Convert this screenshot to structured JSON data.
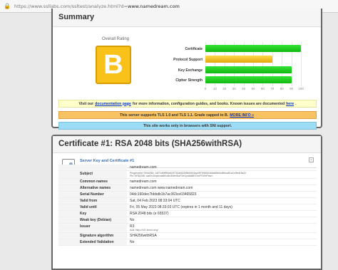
{
  "browser": {
    "url_prefix": "https://www.ssllabs.com/ssltest/analyze.html?d=",
    "url_domain": "www.namedream.com"
  },
  "summary": {
    "title": "Summary",
    "overall_rating_label": "Overall Rating",
    "grade": "B",
    "grade_color": "#f8c21a",
    "notices": {
      "n1_before": "Visit our",
      "n1_link": "documentation page",
      "n1_middle": "for more information, configuration guides, and books. Known issues are documented",
      "n1_link2": "here",
      "n1_end": ".",
      "n2_text": "This server supports TLS 1.0 and TLS 1.1. Grade capped to B.",
      "n2_link": "MORE INFO »",
      "n3_text": "This site works only in browsers with SNI support."
    }
  },
  "chart_data": {
    "type": "bar",
    "categories": [
      "Certificate",
      "Protocol Support",
      "Key Exchange",
      "Cipher Strength"
    ],
    "values": [
      100,
      70,
      90,
      90
    ],
    "colors": [
      "#22cc22",
      "#f0b820",
      "#22cc22",
      "#22cc22"
    ],
    "xlim": [
      0,
      100
    ],
    "ticks": [
      "0",
      "10",
      "20",
      "30",
      "40",
      "50",
      "60",
      "70",
      "80",
      "90",
      "100"
    ]
  },
  "certificate": {
    "title": "Certificate #1: RSA 2048 bits (SHA256withRSA)",
    "section_title": "Server Key and Certificate #1",
    "toggle": "−",
    "rows": [
      {
        "key": "",
        "value": "namedream.com"
      },
      {
        "key": "Subject",
        "value": "Fingerprint SHA256: 4871d0ff59a82f7334d5258b0004aa3f70960b3fda65b0c8bba81a1c9e4f3a1f",
        "value2": "Pin SHA256: ua9X4Vq4mw6Kx8v3WeI5uF2e1pu8d8EOrcFSVhFbw="
      },
      {
        "key": "Common names",
        "value": "namedream.com"
      },
      {
        "key": "Alternative names",
        "value": "namedream.com www.namedream.com"
      },
      {
        "key": "Serial Number",
        "value": "04dc160dec7bbbdb1b7ac363ce03465823"
      },
      {
        "key": "Valid from",
        "value": "Sat, 04 Feb 2023 08:33:04 UTC"
      },
      {
        "key": "Valid until",
        "value": "Fri, 05 May 2023 08:33:03 UTC (expires in 1 month and 11 days)"
      },
      {
        "key": "Key",
        "value": "RSA 2048 bits (e 65537)"
      },
      {
        "key": "Weak key (Debian)",
        "value": "No"
      },
      {
        "key": "Issuer",
        "value": "R3",
        "value2": "AIA: http://r3.i.lencr.org/"
      },
      {
        "key": "Signature algorithm",
        "value": "SHA256withRSA"
      },
      {
        "key": "Extended Validation",
        "value": "No"
      }
    ]
  }
}
